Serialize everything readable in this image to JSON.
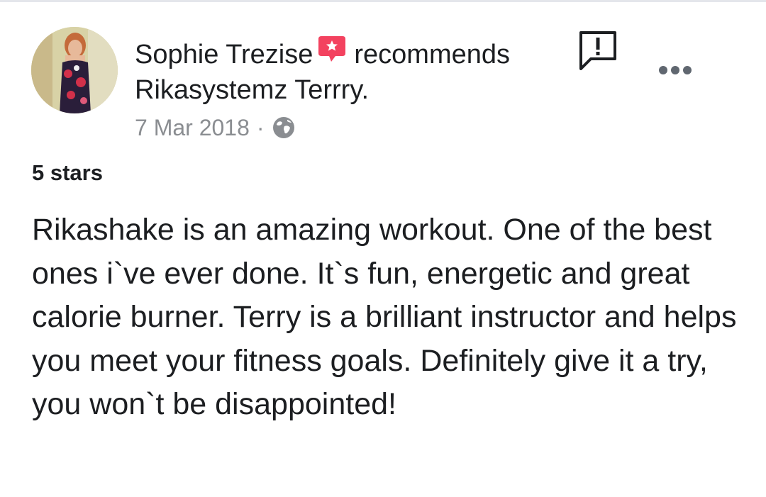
{
  "post": {
    "author_name": "Sophie Trezise",
    "recommends_text": "recommends",
    "page_name": "Rikasystemz Terrry.",
    "timestamp": "7 Mar 2018",
    "separator": "·",
    "privacy_icon": "globe-icon",
    "recommend_icon": "recommend-badge-icon",
    "report_icon": "report-speech-bubble-icon",
    "more_icon": "more-options-icon",
    "rating_text": "5 stars",
    "review_text": "Rikashake is an amazing workout. One of the best ones i`ve ever done. It`s fun, energetic and great calorie burner. Terry is a brilliant instructor and helps you meet your fitness goals. Definitely give it a try, you won`t be disappointed!"
  },
  "colors": {
    "recommend_badge": "#f3425f",
    "meta_text": "#8a8d91",
    "body_text": "#1c1e21",
    "icon_dark": "#1c1e21",
    "globe": "#8a8d91"
  }
}
